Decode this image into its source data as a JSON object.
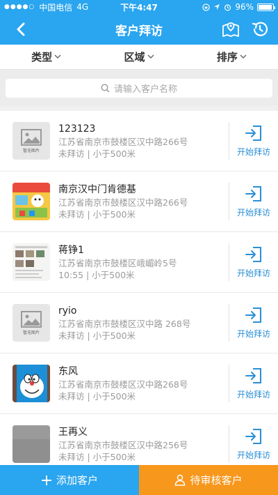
{
  "statusbar": {
    "carrier": "中国电信",
    "network": "4G",
    "time": "下午4:47",
    "battery": "96%",
    "battery_level": 0.96
  },
  "header": {
    "title": "客户拜访",
    "back_icon": "back-arrow-icon",
    "map_icon": "map-pin-icon",
    "history_icon": "history-clock-icon"
  },
  "filters": [
    {
      "label": "类型"
    },
    {
      "label": "区域"
    },
    {
      "label": "排序"
    }
  ],
  "search": {
    "placeholder": "请输入客户名称"
  },
  "customers": [
    {
      "name": "123123",
      "address": "江苏省南京市鼓楼区汉中路266号",
      "status": "未拜访 | 小于500米",
      "thumb": "noimg",
      "noimg_text": "暂无图片",
      "action": "开始拜访"
    },
    {
      "name": "南京汉中门肯德基",
      "address": "江苏省南京市鼓楼区汉中路266号",
      "status": "未拜访 | 小于500米",
      "thumb": "kfc",
      "action": "开始拜访"
    },
    {
      "name": "蒋铮1",
      "address": "江苏省南京市鼓楼区峨嵋岭5号",
      "status": "10:55 | 小于500米",
      "thumb": "doc",
      "action": "开始拜访"
    },
    {
      "name": "ryio",
      "address": "江苏省南京市鼓楼区汉中路 268号",
      "status": "未拜访 | 小于500米",
      "thumb": "noimg",
      "noimg_text": "暂无图片",
      "action": "开始拜访"
    },
    {
      "name": "东风",
      "address": "江苏省南京市鼓楼区汉中路268号",
      "status": "未拜访 | 小于500米",
      "thumb": "doraemon",
      "action": "开始拜访"
    },
    {
      "name": "王再义",
      "address": "江苏省南京市鼓楼区汉中路256号",
      "status": "未拜访 | 小于500米",
      "thumb": "gray",
      "action": "开始拜访"
    }
  ],
  "bottom": {
    "add_label": "添加客户",
    "review_label": "待审核客户"
  },
  "colors": {
    "primary": "#2aa5ef",
    "orange": "#f7971c",
    "action_blue": "#2a8fd6"
  }
}
